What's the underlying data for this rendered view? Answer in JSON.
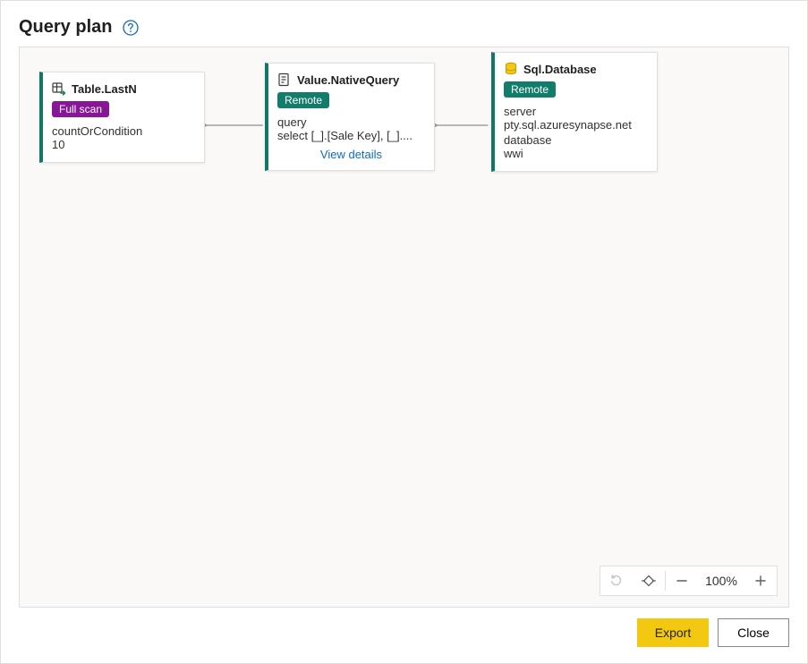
{
  "header": {
    "title": "Query plan"
  },
  "nodes": {
    "tableLastN": {
      "title": "Table.LastN",
      "badge": "Full scan",
      "fieldLabel": "countOrCondition",
      "fieldValue": "10"
    },
    "valueNativeQuery": {
      "title": "Value.NativeQuery",
      "badge": "Remote",
      "fieldLabel": "query",
      "fieldValue": "select [_].[Sale Key], [_]....",
      "details": "View details"
    },
    "sqlDatabase": {
      "title": "Sql.Database",
      "badge": "Remote",
      "field1Label": "server",
      "field1Value": "pty.sql.azuresynapse.net",
      "field2Label": "database",
      "field2Value": "wwi"
    }
  },
  "zoomToolbar": {
    "percent": "100%"
  },
  "footer": {
    "export": "Export",
    "close": "Close"
  }
}
